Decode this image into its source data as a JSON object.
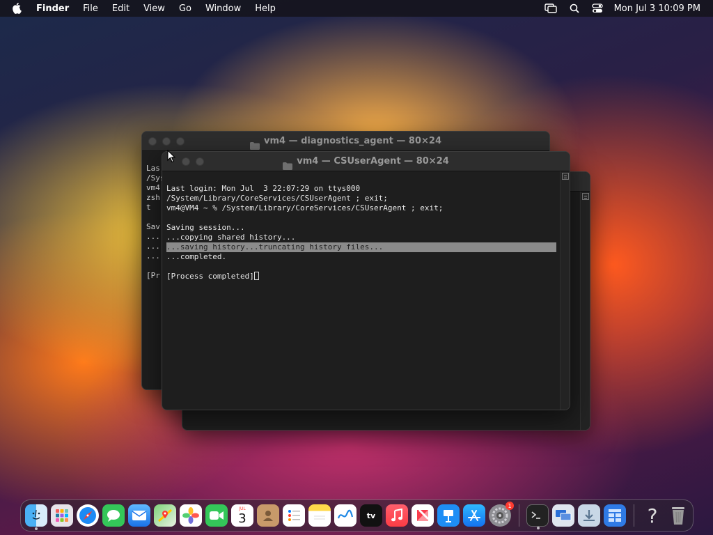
{
  "menubar": {
    "app_name": "Finder",
    "items": [
      "File",
      "Edit",
      "View",
      "Go",
      "Window",
      "Help"
    ],
    "clock": "Mon Jul 3  10:09 PM"
  },
  "windows": {
    "diagnostics": {
      "title": "vm4 — diagnostics_agent — 80×24",
      "lines": [
        "Las",
        "/Sys",
        "vm4",
        "zsh",
        "t",
        "",
        "Sav",
        "...",
        "...",
        "...",
        "",
        "[Pr"
      ]
    },
    "csuseragent": {
      "title": "vm4 — CSUserAgent — 80×24",
      "lines": [
        "Last login: Mon Jul  3 22:07:29 on ttys000",
        "/System/Library/CoreServices/CSUserAgent ; exit;",
        "vm4@VM4 ~ % /System/Library/CoreServices/CSUserAgent ; exit;",
        "",
        "Saving session...",
        "...copying shared history..."
      ],
      "highlight_line": "...saving history...truncating history files...",
      "after_lines": [
        "...completed.",
        "",
        "[Process completed]"
      ]
    }
  },
  "dock": {
    "calendar_month": "JUL",
    "calendar_day": "3",
    "tv_label": "tv",
    "settings_badge": "1",
    "help_label": "?"
  },
  "colors": {
    "terminal_bg": "#1e1e1e",
    "highlight": "#8b8b8b",
    "badge": "#ff3b30"
  }
}
